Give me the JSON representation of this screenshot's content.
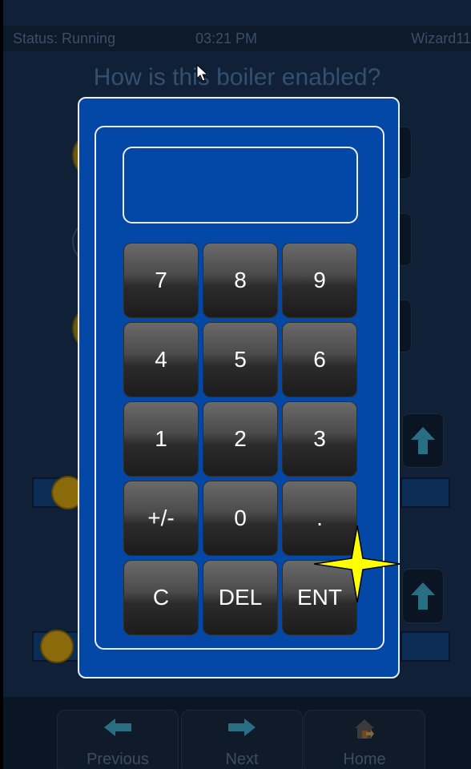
{
  "status_bar": {
    "status": "Status: Running",
    "time": "03:21 PM",
    "wizard": "Wizard11"
  },
  "question": "How is this boiler enabled?",
  "keypad": {
    "display_value": "",
    "keys": [
      [
        "7",
        "8",
        "9"
      ],
      [
        "4",
        "5",
        "6"
      ],
      [
        "1",
        "2",
        "3"
      ],
      [
        "+/-",
        "0",
        "."
      ],
      [
        "C",
        "DEL",
        "ENT"
      ]
    ]
  },
  "nav": {
    "previous": "Previous",
    "next": "Next",
    "home": "Home"
  },
  "colors": {
    "modal_bg": "#0348a6",
    "modal_border": "#e9eef6",
    "app_bg": "#0f2037",
    "highlight": "#ffff00"
  },
  "icons": {
    "previous": "arrow-left-icon",
    "next": "arrow-right-icon",
    "home": "home-exit-icon",
    "scroll": "arrow-up-icon",
    "cursor": "mouse-pointer-icon",
    "marker": "click-sparkle-icon"
  }
}
